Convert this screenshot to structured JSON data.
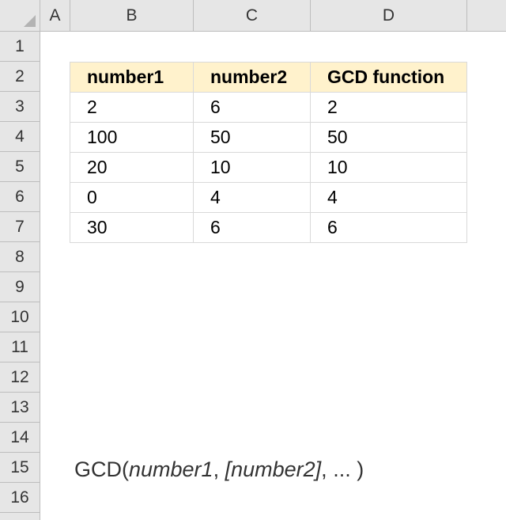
{
  "columns": [
    "A",
    "B",
    "C",
    "D"
  ],
  "rows": [
    "1",
    "2",
    "3",
    "4",
    "5",
    "6",
    "7",
    "8",
    "9",
    "10",
    "11",
    "12",
    "13",
    "14",
    "15",
    "16"
  ],
  "table": {
    "headers": [
      "number1",
      "number2",
      "GCD function"
    ],
    "data": [
      [
        "2",
        "6",
        "2"
      ],
      [
        "100",
        "50",
        "50"
      ],
      [
        "20",
        "10",
        "10"
      ],
      [
        "0",
        "4",
        "4"
      ],
      [
        "30",
        "6",
        "6"
      ]
    ]
  },
  "syntax": {
    "fn": "GCD(",
    "arg1": "number1",
    "sep1": ", ",
    "arg2": "[number2]",
    "sep2": ", ",
    "rest": "... )"
  }
}
